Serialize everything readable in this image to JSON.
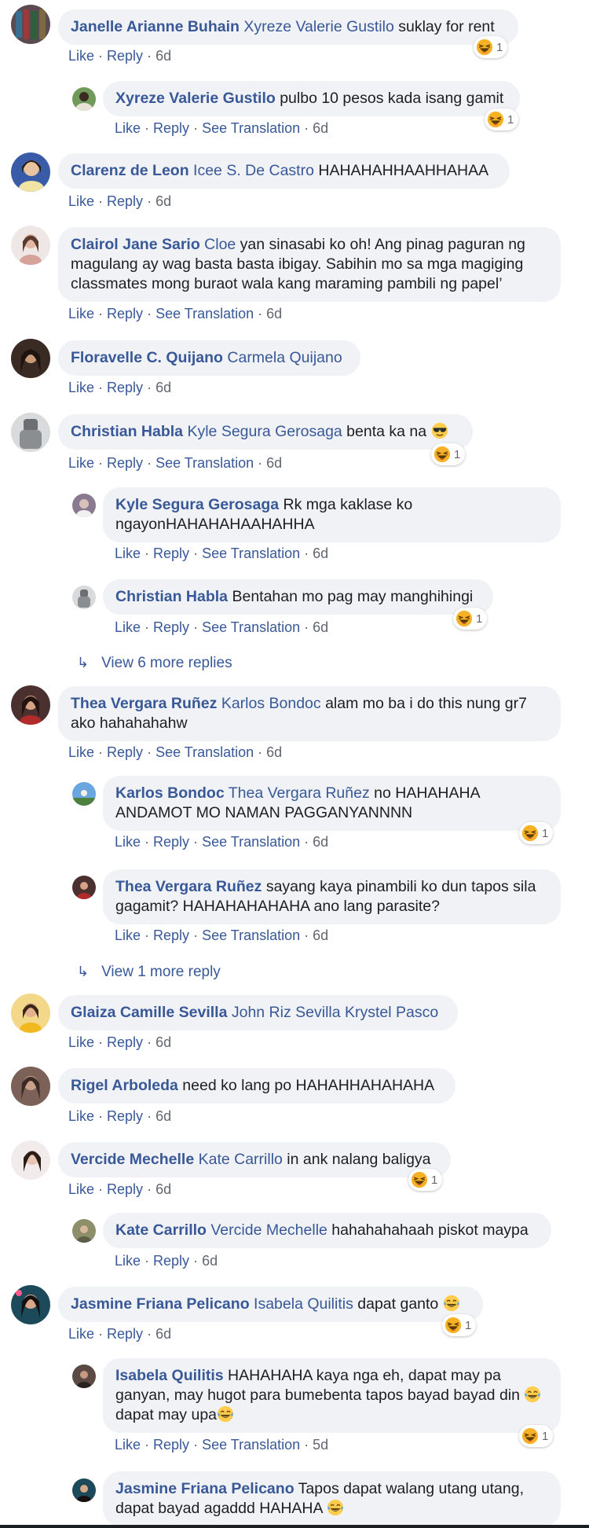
{
  "actions": {
    "like": "Like",
    "reply": "Reply",
    "see_translation": "See Translation"
  },
  "comments": [
    {
      "name": "Janelle Arianne Buhain",
      "tag": "Xyreze Valerie Gustilo",
      "text": " suklay for rent",
      "time": "6d",
      "reaction_count": "1"
    },
    {
      "name": "Xyreze Valerie Gustilo",
      "text": " pulbo 10 pesos kada isang gamit",
      "time": "6d",
      "reaction_count": "1"
    },
    {
      "name": "Clarenz de Leon",
      "tag": "Icee S. De Castro",
      "text": " HAHAHAHHAAHHAHAA",
      "time": "6d"
    },
    {
      "name": "Clairol Jane Sario",
      "tag": "Cloe",
      "text": " yan sinasabi ko oh! Ang pinag paguran ng magulang ay wag basta basta ibigay. Sabihin mo sa mga magiging classmates mong buraot wala kang maraming pambili ng papel’",
      "time": "6d"
    },
    {
      "name": "Floravelle C. Quijano",
      "tag": "Carmela Quijano",
      "text": "",
      "time": "6d"
    },
    {
      "name": "Christian Habla",
      "tag": "Kyle Segura Gerosaga",
      "text": " benta ka na ",
      "time": "6d",
      "reaction_count": "1"
    },
    {
      "name": "Kyle Segura Gerosaga",
      "text": " Rk mga kaklase ko ngayonHAHAHAHAAHAHHA",
      "time": "6d"
    },
    {
      "name": "Christian Habla",
      "text": " Bentahan mo pag may manghihingi",
      "time": "6d",
      "reaction_count": "1"
    },
    {
      "name": "Thea Vergara Ruñez",
      "tag": "Karlos Bondoc",
      "text": " alam mo ba i do this nung gr7 ako hahahahahw",
      "time": "6d"
    },
    {
      "name": "Karlos Bondoc",
      "tag": "Thea Vergara Ruñez",
      "text": " no HAHAHAHA ANDAMOT MO NAMAN PAGGANYANNNN",
      "time": "6d",
      "reaction_count": "1"
    },
    {
      "name": "Thea Vergara Ruñez",
      "text": " sayang kaya pinambili ko dun tapos sila gagamit? HAHAHAHAHAHA ano lang parasite?",
      "time": "6d"
    },
    {
      "name": "Glaiza Camille Sevilla",
      "tag": "John Riz Sevilla Krystel Pasco",
      "text": "",
      "time": "6d"
    },
    {
      "name": "Rigel Arboleda",
      "text": " need ko lang po HAHAHHAHAHAHA",
      "time": "6d"
    },
    {
      "name": "Vercide Mechelle",
      "tag": "Kate Carrillo",
      "text": " in ank nalang baligya",
      "time": "6d",
      "reaction_count": "1"
    },
    {
      "name": "Kate Carrillo",
      "tag": "Vercide Mechelle",
      "text": " hahahahahaah piskot maypa",
      "time": "6d"
    },
    {
      "name": "Jasmine Friana Pelicano",
      "tag": "Isabela Quilitis",
      "text": " dapat ganto ",
      "time": "6d",
      "reaction_count": "1"
    },
    {
      "name": "Isabela Quilitis",
      "text": " HAHAHAHA kaya nga eh, dapat may pa ganyan, may hugot para bumebenta tapos bayad bayad din ",
      "text2": " dapat may upa",
      "time": "5d",
      "reaction_count": "1"
    },
    {
      "name": "Jasmine Friana Pelicano",
      "text": " Tapos dapat walang utang utang, dapat bayad agaddd HAHAHA "
    }
  ],
  "more_replies": [
    "View 6 more replies",
    "View 1 more reply"
  ],
  "icons": {
    "reaction": "haha-emoji",
    "reply_arrow": "reply-arrow-icon",
    "sunglasses": "sunglasses-emoji",
    "tears_joy": "tears-of-joy-emoji"
  },
  "colors": {
    "name": "#385898",
    "bubble": "#f0f2f5",
    "text": "#1c1e21",
    "meta": "#606770"
  }
}
